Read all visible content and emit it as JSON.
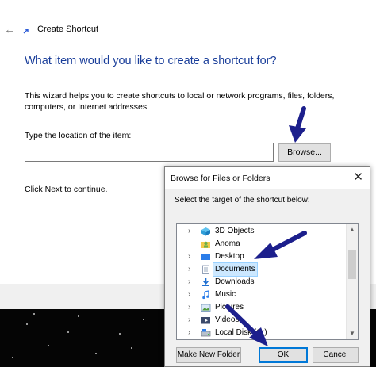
{
  "wizard": {
    "title": "Create Shortcut",
    "heading": "What item would you like to create a shortcut for?",
    "description": "This wizard helps you to create shortcuts to local or network programs, files, folders, computers, or Internet addresses.",
    "location_label": "Type the location of the item:",
    "location_value": "",
    "browse_label": "Browse...",
    "next_hint": "Click Next to continue."
  },
  "dialog": {
    "title": "Browse for Files or Folders",
    "prompt": "Select the target of the shortcut below:",
    "tree": [
      {
        "label": "3D Objects",
        "icon": "3d-objects-icon",
        "selected": false
      },
      {
        "label": "Anoma",
        "icon": "user-folder-icon",
        "selected": false
      },
      {
        "label": "Desktop",
        "icon": "desktop-icon",
        "selected": false
      },
      {
        "label": "Documents",
        "icon": "documents-icon",
        "selected": true
      },
      {
        "label": "Downloads",
        "icon": "downloads-icon",
        "selected": false
      },
      {
        "label": "Music",
        "icon": "music-icon",
        "selected": false
      },
      {
        "label": "Pictures",
        "icon": "pictures-icon",
        "selected": false
      },
      {
        "label": "Videos",
        "icon": "videos-icon",
        "selected": false
      },
      {
        "label": "Local Disk (C:)",
        "icon": "drive-icon",
        "selected": false
      }
    ],
    "buttons": {
      "make_new_folder": "Make New Folder",
      "ok": "OK",
      "cancel": "Cancel"
    }
  },
  "colors": {
    "heading": "#1a3e9a",
    "selection": "#cce8ff",
    "annotation_arrow": "#1c1f8c"
  }
}
